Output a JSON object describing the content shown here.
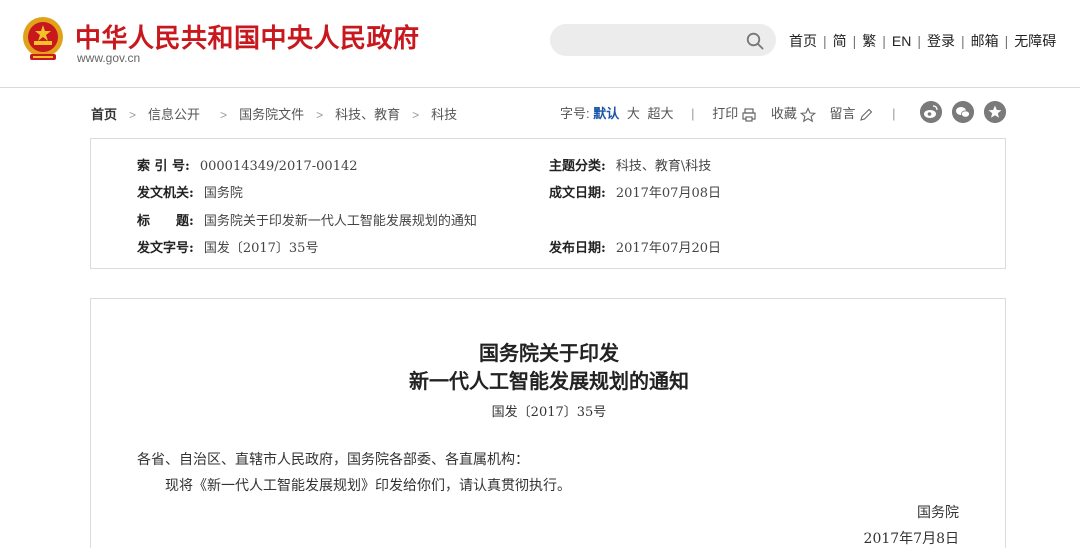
{
  "header": {
    "site_name": "中华人民共和国中央人民政府",
    "site_domain": "www.gov.cn",
    "search_placeholder": "",
    "nav": [
      "首页",
      "简",
      "繁",
      "EN",
      "登录",
      "邮箱",
      "无障碍"
    ]
  },
  "breadcrumb": [
    "首页",
    "信息公开",
    "国务院文件",
    "科技、教育",
    "科技"
  ],
  "tools": {
    "font_label": "字号:",
    "font_sizes": [
      "默认",
      "大",
      "超大"
    ],
    "print": "打印",
    "favorite": "收藏",
    "comment": "留言"
  },
  "info": {
    "index_label": "索 引 号:",
    "index_value": "000014349/2017-00142",
    "topic_label": "主题分类:",
    "topic_value": "科技、教育\\科技",
    "issuer_label": "发文机关:",
    "issuer_value": "国务院",
    "date_written_label": "成文日期:",
    "date_written_value": "2017年07月08日",
    "title_label": "标　　题:",
    "title_value": "国务院关于印发新一代人工智能发展规划的通知",
    "doc_number_label": "发文字号:",
    "doc_number_value": "国发〔2017〕35号",
    "publish_label": "发布日期:",
    "publish_value": "2017年07月20日"
  },
  "document": {
    "title_line1": "国务院关于印发",
    "title_line2": "新一代人工智能发展规划的通知",
    "number": "国发〔2017〕35号",
    "salutation": "各省、自治区、直辖市人民政府，国务院各部委、各直属机构：",
    "body": "现将《新一代人工智能发展规划》印发给你们，请认真贯彻执行。",
    "signature": "国务院",
    "date": "2017年7月8日"
  },
  "colors": {
    "brand_red": "#c8171d",
    "link_blue": "#1b56a7",
    "share_gray": "#777777"
  },
  "icons": [
    "emblem-icon",
    "search-icon",
    "printer-icon",
    "star-icon",
    "pencil-icon",
    "weibo-icon",
    "wechat-icon",
    "favorite-icon"
  ]
}
